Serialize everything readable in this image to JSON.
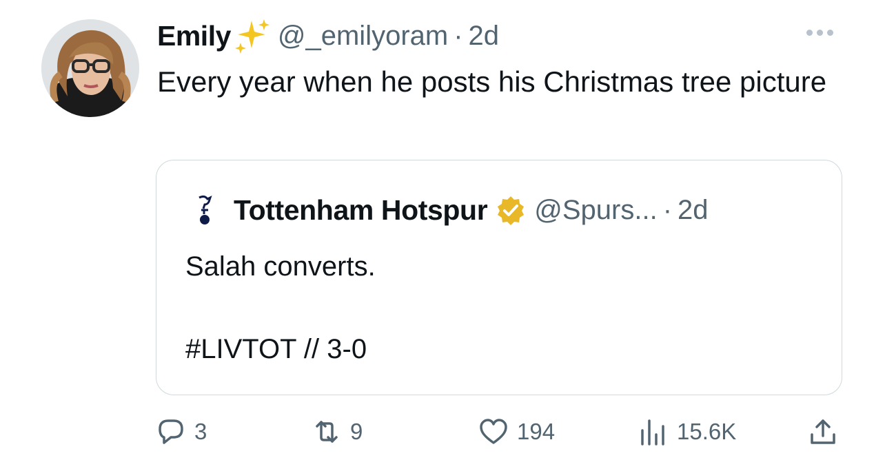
{
  "tweet": {
    "author_name": "Emily",
    "author_handle": "@_emilyoram",
    "separator": "·",
    "time": "2d",
    "text": "Every year when he posts his Christmas tree picture"
  },
  "quoted_tweet": {
    "author_name": "Tottenham Hotspur",
    "author_handle": "@Spurs...",
    "separator": "·",
    "time": "2d",
    "text": "Salah converts.\n\n#LIVTOT // 3-0",
    "verified_color": "#e8b829"
  },
  "actions": {
    "replies": "3",
    "retweets": "9",
    "likes": "194",
    "views": "15.6K"
  },
  "icons": {
    "sparkles": "sparkles-icon",
    "more": "more-icon",
    "verified": "verified-badge-icon",
    "reply": "reply-icon",
    "retweet": "retweet-icon",
    "like": "heart-icon",
    "views": "views-chart-icon",
    "share": "share-icon"
  }
}
